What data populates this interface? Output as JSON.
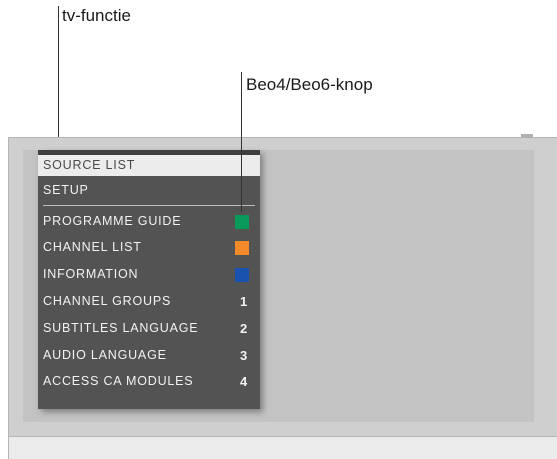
{
  "callouts": {
    "tv_function": "tv-functie",
    "remote_button": "Beo4/Beo6-knop"
  },
  "menu": {
    "selected": "SOURCE LIST",
    "setup": "SETUP",
    "items": [
      {
        "label": "PROGRAMME GUIDE",
        "key": "",
        "color": "#0a9a5a",
        "icon": "green-button-icon"
      },
      {
        "label": "CHANNEL LIST",
        "key": "",
        "color": "#f28a2a",
        "icon": "orange-button-icon"
      },
      {
        "label": "INFORMATION",
        "key": "",
        "color": "#1a52b0",
        "icon": "blue-button-icon"
      },
      {
        "label": "CHANNEL GROUPS",
        "key": "1"
      },
      {
        "label": "SUBTITLES LANGUAGE",
        "key": "2"
      },
      {
        "label": "AUDIO LANGUAGE",
        "key": "3"
      },
      {
        "label": "ACCESS CA MODULES",
        "key": "4"
      }
    ]
  },
  "colors": {
    "menu_bg": "#535353",
    "selected_bg": "#ececec",
    "green": "#0a9a5a",
    "orange": "#f28a2a",
    "blue": "#1a52b0"
  }
}
